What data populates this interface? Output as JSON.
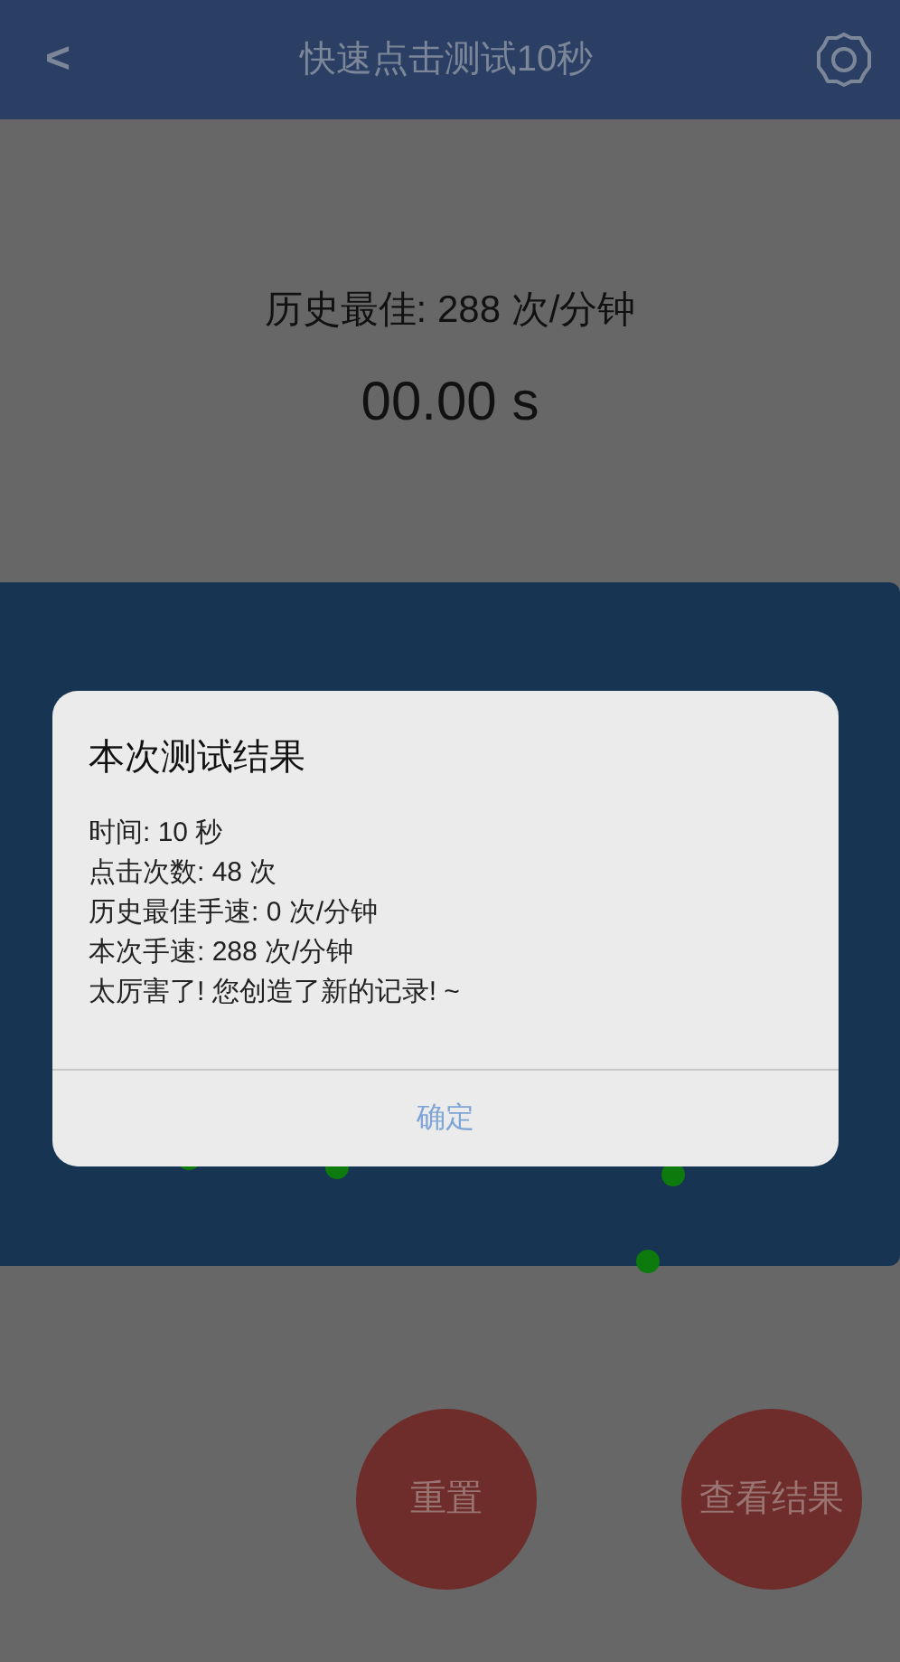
{
  "header": {
    "back": "<",
    "title": "快速点击测试10秒"
  },
  "best_score": "历史最佳: 288 次/分钟",
  "timer": "00.00 s",
  "buttons": [
    "重置",
    "查看结果"
  ],
  "dialog": {
    "title": "本次测试结果",
    "lines": [
      "时间: 10 秒",
      "点击次数: 48 次",
      "历史最佳手速: 0 次/分钟",
      "本次手速: 288 次/分钟",
      "太厉害了! 您创造了新的记录! ~"
    ],
    "confirm": "确定"
  }
}
